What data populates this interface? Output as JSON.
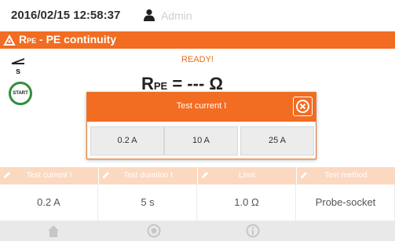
{
  "statusbar": {
    "datetime": "2016/02/15 12:58:37",
    "user": "Admin"
  },
  "titlebar": {
    "title_r": "R",
    "title_sub": "PE",
    "title_rest": " - PE continuity"
  },
  "measurement": {
    "status": "READY!",
    "label_r": "R",
    "label_sub": "PE",
    "value": " = --- Ω"
  },
  "start_button": {
    "label": "START"
  },
  "dialog": {
    "title": "Test current I",
    "options": [
      "0.2 A",
      "10 A",
      "25 A"
    ]
  },
  "params": [
    {
      "header": "Test current I",
      "value": "0.2 A"
    },
    {
      "header": "Test duration t",
      "value": "5 s"
    },
    {
      "header": "Limit",
      "value": "1.0 Ω"
    },
    {
      "header": "Test method",
      "value": "Probe-socket"
    }
  ],
  "colors": {
    "accent": "#f26c21",
    "start_green": "#2f8f3a",
    "header_light": "#fbd8c0"
  },
  "icons": [
    "user-icon",
    "ground-icon",
    "close-icon",
    "edit-icon",
    "home-icon",
    "record-icon",
    "info-icon"
  ]
}
